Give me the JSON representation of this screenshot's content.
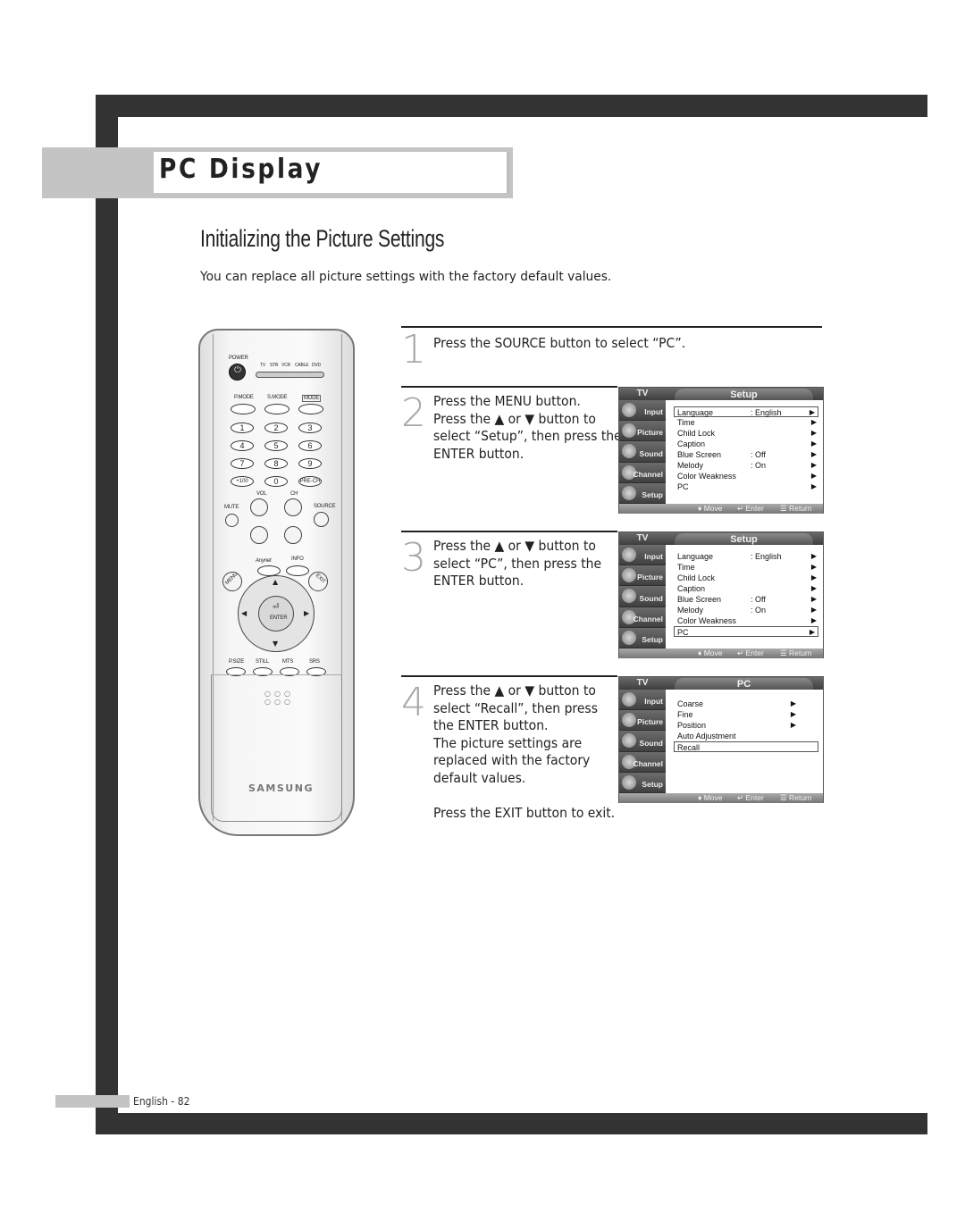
{
  "header": {
    "section_label": "PC Display",
    "page_title": "Initializing the Picture Settings",
    "intro": "You can replace all picture settings with the factory default values."
  },
  "steps": [
    {
      "number": "1",
      "lines": [
        "Press the SOURCE button to select “PC”."
      ]
    },
    {
      "number": "2",
      "lines": [
        "Press the MENU button.",
        "Press the ▲ or ▼ button to",
        "select “Setup”, then press the",
        "ENTER button."
      ]
    },
    {
      "number": "3",
      "lines": [
        "Press the ▲ or ▼ button to",
        "select “PC”, then press the",
        "ENTER button."
      ]
    },
    {
      "number": "4",
      "lines": [
        "Press the ▲ or ▼ button to",
        "select “Recall”, then press",
        "the ENTER button.",
        "The picture settings are",
        "replaced with the factory",
        "default values.",
        "",
        "Press the EXIT button to exit."
      ]
    }
  ],
  "osd_common": {
    "tv_label": "TV",
    "side_menu": [
      "Input",
      "Picture",
      "Sound",
      "Channel",
      "Setup"
    ],
    "footer": {
      "move": "♦ Move",
      "enter": "↵ Enter",
      "return": "☰ Return"
    },
    "arrow": "▶"
  },
  "osd_screens": [
    {
      "title": "Setup",
      "rows": [
        {
          "name": "Language",
          "value": ": English",
          "arrow": true,
          "selected": true
        },
        {
          "name": "Time",
          "value": "",
          "arrow": true,
          "selected": false
        },
        {
          "name": "Child Lock",
          "value": "",
          "arrow": true,
          "selected": false
        },
        {
          "name": "Caption",
          "value": "",
          "arrow": true,
          "selected": false
        },
        {
          "name": "Blue Screen",
          "value": ": Off",
          "arrow": true,
          "selected": false
        },
        {
          "name": "Melody",
          "value": ": On",
          "arrow": true,
          "selected": false
        },
        {
          "name": "Color Weakness",
          "value": "",
          "arrow": true,
          "selected": false
        },
        {
          "name": "PC",
          "value": "",
          "arrow": true,
          "selected": false
        }
      ]
    },
    {
      "title": "Setup",
      "rows": [
        {
          "name": "Language",
          "value": ": English",
          "arrow": true,
          "selected": false
        },
        {
          "name": "Time",
          "value": "",
          "arrow": true,
          "selected": false
        },
        {
          "name": "Child Lock",
          "value": "",
          "arrow": true,
          "selected": false
        },
        {
          "name": "Caption",
          "value": "",
          "arrow": true,
          "selected": false
        },
        {
          "name": "Blue Screen",
          "value": ": Off",
          "arrow": true,
          "selected": false
        },
        {
          "name": "Melody",
          "value": ": On",
          "arrow": true,
          "selected": false
        },
        {
          "name": "Color Weakness",
          "value": "",
          "arrow": true,
          "selected": false
        },
        {
          "name": "PC",
          "value": "",
          "arrow": true,
          "selected": true
        }
      ]
    },
    {
      "title": "PC",
      "rows": [
        {
          "name": "Coarse",
          "value": "",
          "arrow": true,
          "selected": false,
          "arrow_inset": true
        },
        {
          "name": "Fine",
          "value": "",
          "arrow": true,
          "selected": false,
          "arrow_inset": true
        },
        {
          "name": "Position",
          "value": "",
          "arrow": true,
          "selected": false,
          "arrow_inset": true
        },
        {
          "name": "Auto Adjustment",
          "value": "",
          "arrow": false,
          "selected": false
        },
        {
          "name": "Recall",
          "value": "",
          "arrow": false,
          "selected": true
        }
      ]
    }
  ],
  "remote": {
    "power": "POWER",
    "modes": [
      "TV",
      "STB",
      "VCR",
      "CABLE",
      "DVD"
    ],
    "mode_labels": [
      "P.MODE",
      "S.MODE",
      "MODE"
    ],
    "numbers": [
      "1",
      "2",
      "3",
      "4",
      "5",
      "6",
      "7",
      "8",
      "9",
      "+100",
      "0",
      "PRE-CH"
    ],
    "vol": "VOL",
    "ch": "CH",
    "mute": "MUTE",
    "source": "SOURCE",
    "anynet": "Anynet",
    "info": "INFO",
    "menu": "MENU",
    "exit": "EXIT",
    "enter": "ENTER",
    "bottom_labels": [
      "P.SIZE",
      "STILL",
      "MTS",
      "SRS"
    ],
    "brand": "SAMSUNG"
  },
  "footer": {
    "page_label": "English - 82"
  }
}
